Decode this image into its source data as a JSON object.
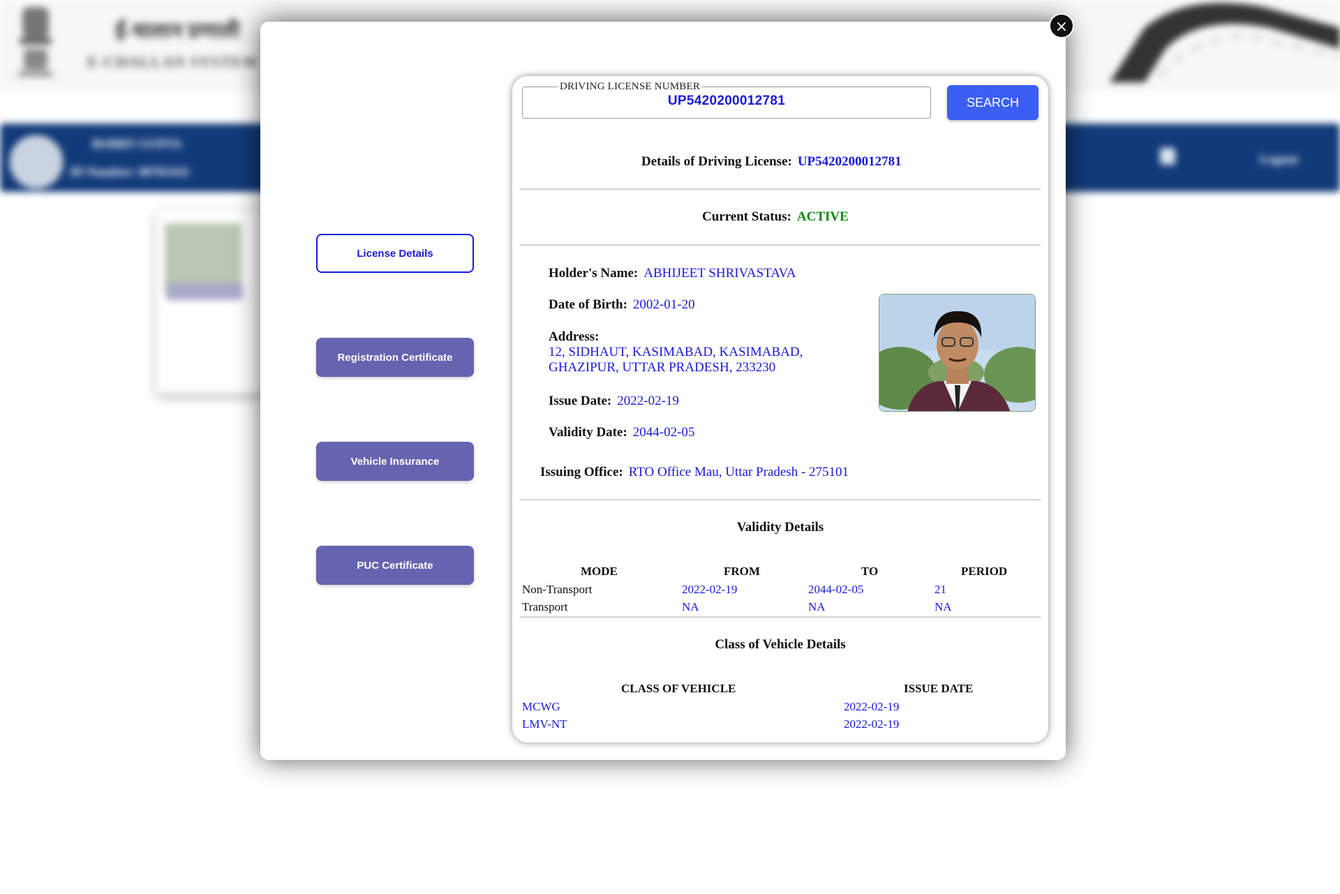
{
  "background": {
    "title_hi": "ई-चालान प्रणाली",
    "title_en": "E-CHALLAN SYSTEM",
    "officer_name": "BOBBY GUPTA",
    "officer_id": "ID Number: 00765432",
    "logout_label": "Logout"
  },
  "modal": {
    "close_label": "×",
    "side_buttons": [
      {
        "label": "License Details"
      },
      {
        "label": "Registration Certificate"
      },
      {
        "label": "Vehicle Insurance"
      },
      {
        "label": "PUC Certificate"
      }
    ]
  },
  "search": {
    "legend": "DRIVING LICENSE NUMBER",
    "value": "UP5420200012781",
    "button_label": "SEARCH"
  },
  "details": {
    "heading_label": "Details of Driving License:",
    "heading_value": "UP5420200012781",
    "status_label": "Current Status:",
    "status_value": "ACTIVE",
    "holder_label": "Holder's Name:",
    "holder_value": "ABHIJEET SHRIVASTAVA",
    "dob_label": "Date of Birth:",
    "dob_value": "2002-01-20",
    "address_label": "Address:",
    "address_line1": "12, SIDHAUT, KASIMABAD, KASIMABAD,",
    "address_line2": "GHAZIPUR, UTTAR PRADESH, 233230",
    "issue_label": "Issue Date:",
    "issue_value": "2022-02-19",
    "validity_label": "Validity Date:",
    "validity_value": "2044-02-05",
    "office_label": "Issuing Office:",
    "office_value": "RTO Office Mau, Uttar Pradesh - 275101"
  },
  "validity_table": {
    "title": "Validity Details",
    "headers": [
      "MODE",
      "FROM",
      "TO",
      "PERIOD"
    ],
    "rows": [
      [
        "Non-Transport",
        "2022-02-19",
        "2044-02-05",
        "21"
      ],
      [
        "Transport",
        "NA",
        "NA",
        "NA"
      ]
    ]
  },
  "class_table": {
    "title": "Class of Vehicle Details",
    "headers": [
      "CLASS OF VEHICLE",
      "ISSUE DATE"
    ],
    "rows": [
      [
        "MCWG",
        "2022-02-19"
      ],
      [
        "LMV-NT",
        "2022-02-19"
      ]
    ]
  },
  "colors": {
    "accent_blue": "#1a1ad6",
    "status_green": "#0a8a0a",
    "button_purple": "#6663b0",
    "search_button": "#3b5ff5",
    "nav_blue": "#123a7a"
  }
}
